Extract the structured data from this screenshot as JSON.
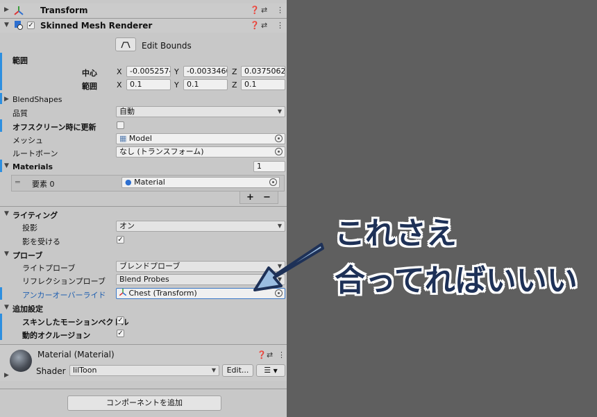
{
  "transform": {
    "title": "Transform"
  },
  "renderer": {
    "title": "Skinned Mesh Renderer",
    "edit_bounds_label": "Edit Bounds",
    "bounds_label": "範囲",
    "center_label": "中心",
    "extent_label": "範囲",
    "center": {
      "x": "-0.0052574",
      "y": "-0.0033460",
      "z": "0.0375062"
    },
    "extent": {
      "x": "0.1",
      "y": "0.1",
      "z": "0.1"
    },
    "axis_x": "X",
    "axis_y": "Y",
    "axis_z": "Z",
    "blendshapes_label": "BlendShapes",
    "quality_label": "品質",
    "quality_value": "自動",
    "offscreen_label": "オフスクリーン時に更新",
    "mesh_label": "メッシュ",
    "mesh_value": "Model",
    "rootbone_label": "ルートボーン",
    "rootbone_value": "なし (トランスフォーム)",
    "materials_label": "Materials",
    "materials_count": "1",
    "element0_label": "要素 0",
    "element0_value": "Material",
    "plus": "+",
    "minus": "−",
    "lighting_label": "ライティング",
    "cast_shadows_label": "投影",
    "cast_shadows_value": "オン",
    "receive_shadows_label": "影を受ける",
    "probes_label": "プローブ",
    "light_probes_label": "ライトプローブ",
    "light_probes_value": "ブレンドプローブ",
    "reflection_probes_label": "リフレクションプローブ",
    "reflection_probes_value": "Blend Probes",
    "anchor_label": "アンカーオーバーライド",
    "anchor_value": "Chest (Transform)",
    "additional_label": "追加設定",
    "motion_vectors_label": "スキンしたモーションベクトル",
    "dynamic_occlusion_label": "動的オクルージョン"
  },
  "material": {
    "title": "Material (Material)",
    "shader_label": "Shader",
    "shader_value": "lilToon",
    "edit_label": "Edit..."
  },
  "add_component_label": "コンポーネントを追加",
  "annotation": {
    "line1": "これさえ",
    "line2": "合ってればいいい"
  }
}
